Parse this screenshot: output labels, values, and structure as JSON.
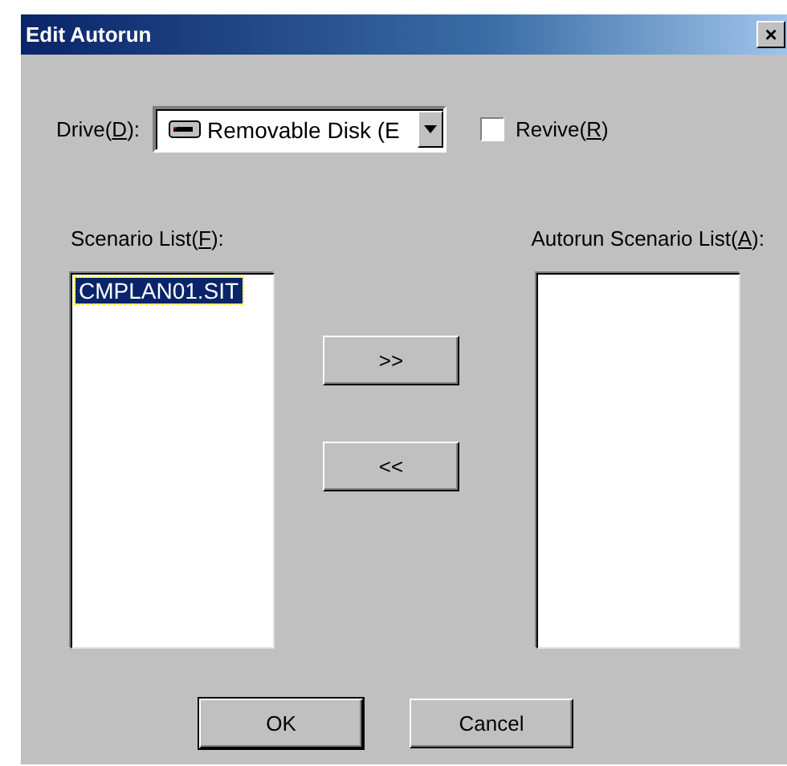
{
  "window": {
    "title": "Edit Autorun",
    "close": "×"
  },
  "drive": {
    "label": {
      "before": "Drive(",
      "key": "D",
      "after": "):"
    },
    "value": "Removable Disk (E"
  },
  "revive": {
    "label": {
      "before": "Revive(",
      "key": "R",
      "after": ")"
    },
    "checked": false
  },
  "scenario_list": {
    "label": {
      "before": "Scenario List(",
      "key": "F",
      "after": "):"
    },
    "items": [
      {
        "text": "CMPLAN01.SIT",
        "selected": true
      }
    ]
  },
  "autorun_list": {
    "label": {
      "before": "Autorun Scenario List(",
      "key": "A",
      "after": "):"
    }
  },
  "move_buttons": [
    ">>",
    "<<"
  ],
  "buttons": [
    "OK",
    "Cancel"
  ]
}
